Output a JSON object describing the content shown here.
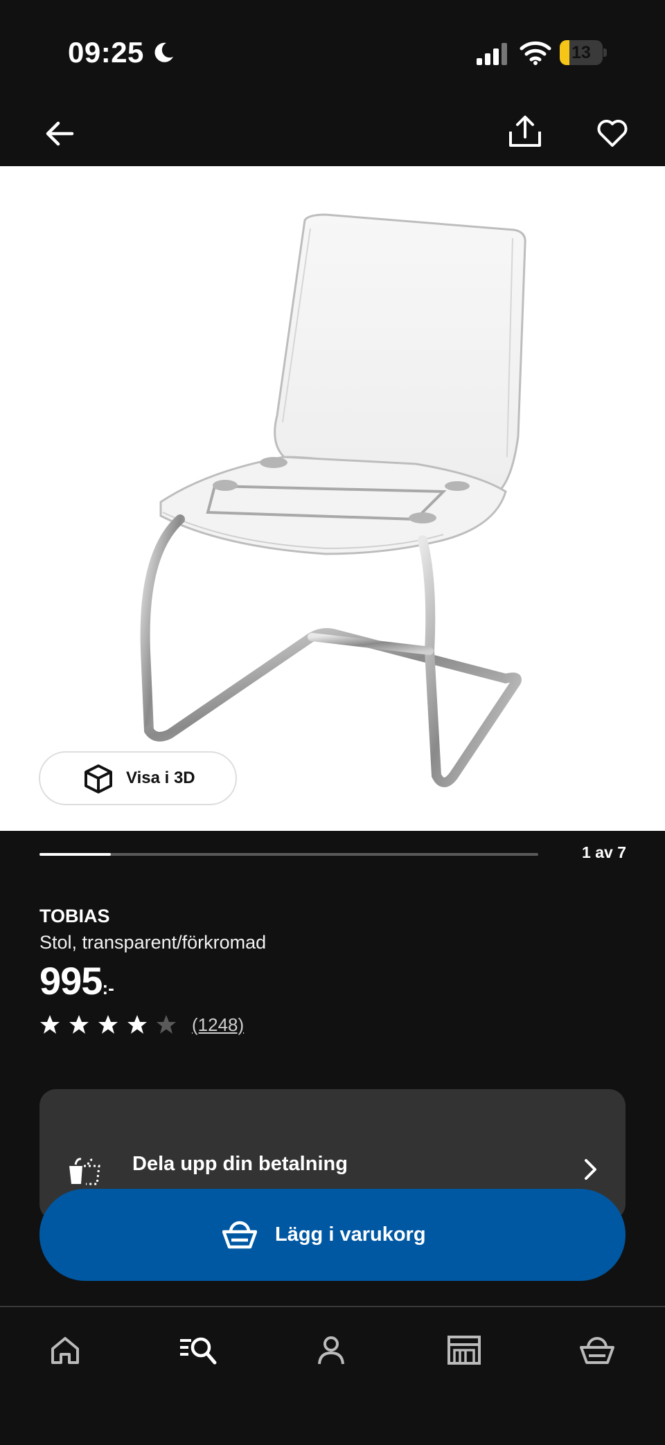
{
  "status_bar": {
    "time": "09:25",
    "battery_level": "13",
    "battery_fraction": 0.13,
    "battery_color": "#f5c518",
    "icons": [
      "moon-icon",
      "signal-icon",
      "wifi-icon",
      "battery-icon"
    ]
  },
  "top_nav": {
    "icons": [
      "back-arrow-icon",
      "share-icon",
      "heart-icon"
    ]
  },
  "gallery": {
    "view_3d_label": "Visa i 3D",
    "current_index": 1,
    "total": 7,
    "counter_text": "1 av 7",
    "progress_fraction": 0.143
  },
  "product": {
    "name": "TOBIAS",
    "description": "Stol, transparent/förkromad",
    "price": "995",
    "price_suffix": ":-",
    "rating": 4,
    "rating_max": 5,
    "review_count": "(1248)"
  },
  "payment": {
    "label": "Dela upp din betalning",
    "icon": "split-payment-icon"
  },
  "cart_button": {
    "label": "Lägg i varukorg",
    "color": "#0058a3"
  },
  "tabbar": {
    "items": [
      "home-icon",
      "search-icon",
      "profile-icon",
      "store-icon",
      "basket-icon"
    ]
  }
}
